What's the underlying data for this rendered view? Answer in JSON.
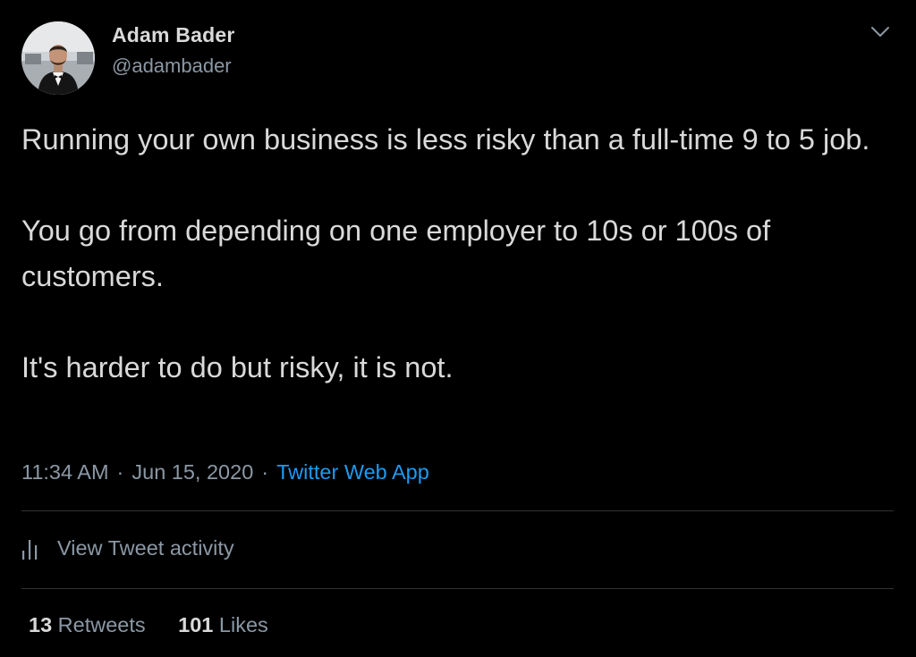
{
  "author": {
    "display_name": "Adam Bader",
    "handle": "@adambader",
    "avatar_icon": "profile-photo-icon"
  },
  "menu": {
    "icon": "chevron-down-icon"
  },
  "tweet": {
    "paragraphs": [
      "Running your own business is less risky than a full-time 9 to 5 job.",
      "You go from depending on one employer to 10s or 100s of customers.",
      "It's harder to do but risky, it is not."
    ]
  },
  "meta": {
    "time": "11:34 AM",
    "separator": "·",
    "date": "Jun 15, 2020",
    "source": "Twitter Web App"
  },
  "activity": {
    "label": "View Tweet activity",
    "icon": "bar-chart-icon"
  },
  "stats": {
    "retweets_count": "13",
    "retweets_label": "Retweets",
    "likes_count": "101",
    "likes_label": "Likes"
  },
  "colors": {
    "background": "#000000",
    "text_primary": "#d9d9d9",
    "text_secondary": "#8b98a5",
    "link": "#1d9bf0",
    "divider": "#2f3336"
  }
}
